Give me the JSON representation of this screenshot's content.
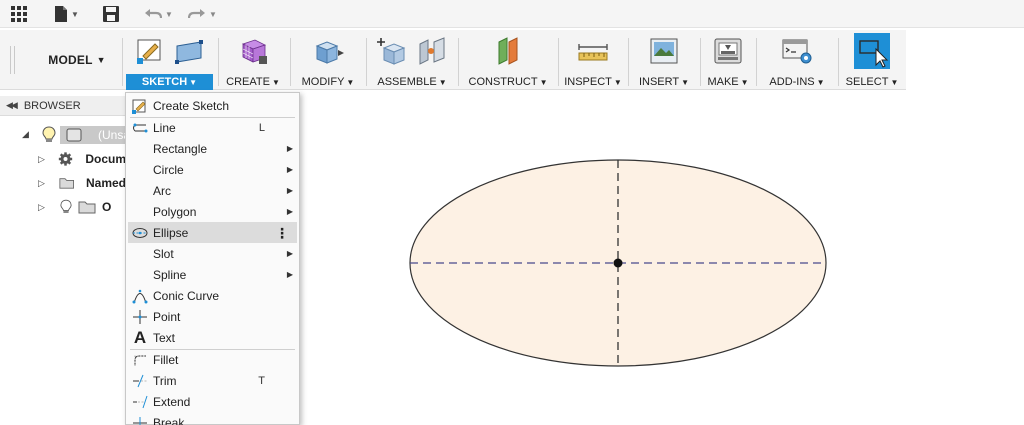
{
  "ribbon": {
    "workspace": "MODEL",
    "groups": [
      {
        "label": "SKETCH"
      },
      {
        "label": "CREATE"
      },
      {
        "label": "MODIFY"
      },
      {
        "label": "ASSEMBLE"
      },
      {
        "label": "CONSTRUCT"
      },
      {
        "label": "INSPECT"
      },
      {
        "label": "INSERT"
      },
      {
        "label": "MAKE"
      },
      {
        "label": "ADD-INS"
      },
      {
        "label": "SELECT"
      }
    ]
  },
  "browser": {
    "title": "BROWSER",
    "items": [
      {
        "label": "(Unsa"
      },
      {
        "label": "Docum"
      },
      {
        "label": "Named"
      },
      {
        "label": "O"
      }
    ]
  },
  "menu": {
    "items": [
      {
        "label": "Create Sketch",
        "shortcut": ""
      },
      {
        "label": "Line",
        "shortcut": "L"
      },
      {
        "label": "Rectangle",
        "shortcut": ""
      },
      {
        "label": "Circle",
        "shortcut": ""
      },
      {
        "label": "Arc",
        "shortcut": ""
      },
      {
        "label": "Polygon",
        "shortcut": ""
      },
      {
        "label": "Ellipse",
        "shortcut": ""
      },
      {
        "label": "Slot",
        "shortcut": ""
      },
      {
        "label": "Spline",
        "shortcut": ""
      },
      {
        "label": "Conic Curve",
        "shortcut": ""
      },
      {
        "label": "Point",
        "shortcut": ""
      },
      {
        "label": "Text",
        "shortcut": ""
      },
      {
        "label": "Fillet",
        "shortcut": ""
      },
      {
        "label": "Trim",
        "shortcut": "T"
      },
      {
        "label": "Extend",
        "shortcut": ""
      },
      {
        "label": "Break",
        "shortcut": ""
      }
    ],
    "highlighted": "Ellipse"
  },
  "colors": {
    "accent": "#1e8fd6",
    "ellipse_fill": "#fdf1e4",
    "axis_dash": "#4a4a8c"
  },
  "icons": [
    "apps-grid-icon",
    "file-icon",
    "save-icon",
    "undo-icon",
    "redo-icon"
  ]
}
